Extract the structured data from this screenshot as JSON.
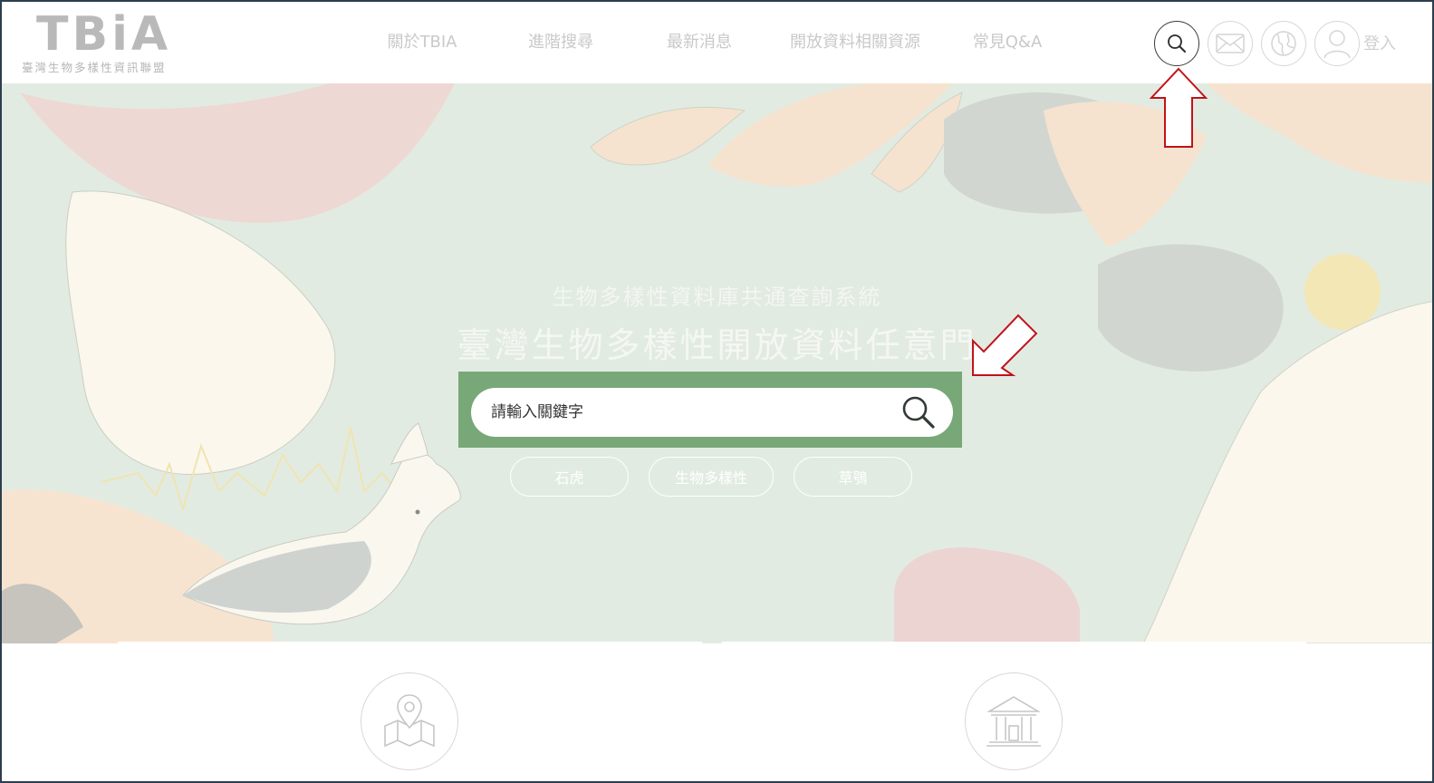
{
  "logo": {
    "mark": "TBiA",
    "subtitle": "臺灣生物多樣性資訊聯盟"
  },
  "nav": {
    "items": [
      {
        "label": "關於TBIA"
      },
      {
        "label": "進階搜尋"
      },
      {
        "label": "最新消息"
      },
      {
        "label": "開放資料相關資源"
      },
      {
        "label": "常見Q&A"
      }
    ],
    "login_label": "登入"
  },
  "header_icons": [
    "search-icon",
    "mail-icon",
    "globe-icon",
    "user-icon"
  ],
  "hero": {
    "subtitle": "生物多樣性資料庫共通查詢系統",
    "title": "臺灣生物多樣性開放資料任意門",
    "search": {
      "placeholder": "請輸入關鍵字",
      "value": ""
    },
    "tags": [
      {
        "label": "石虎"
      },
      {
        "label": "生物多樣性"
      },
      {
        "label": "草鴞"
      }
    ]
  },
  "cards": [
    {
      "icon": "map-location-icon"
    },
    {
      "icon": "museum-icon"
    }
  ],
  "colors": {
    "hero_background": "#e2ebe2",
    "search_panel": "#78a878",
    "annotation_arrow": "#c0131a",
    "nav_text": "#c9c9c9"
  }
}
